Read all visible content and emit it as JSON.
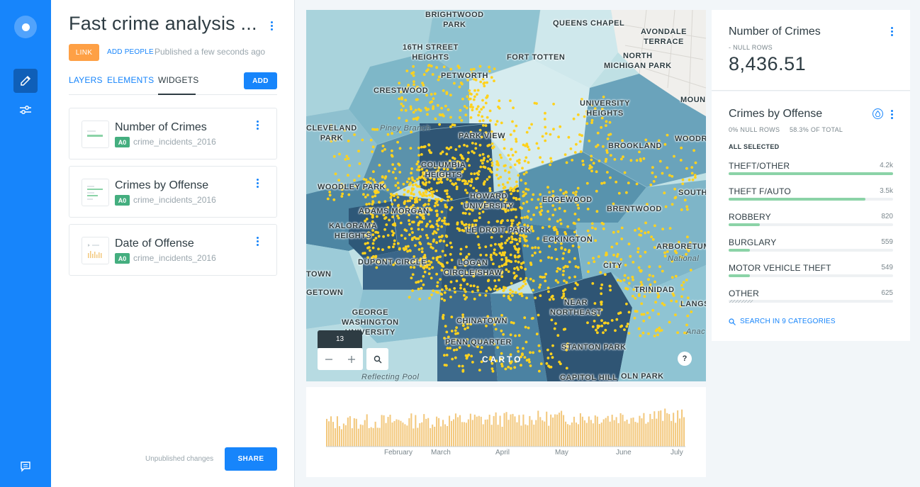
{
  "sidebar": {
    "nav": [
      "edit-map",
      "map-settings",
      "feedback"
    ]
  },
  "editor": {
    "title": "Fast crime analysis ...",
    "link_label": "LINK",
    "add_people_label": "ADD PEOPLE",
    "published_text": "Published a few seconds ago",
    "tabs": [
      {
        "label": "LAYERS"
      },
      {
        "label": "ELEMENTS"
      },
      {
        "label": "WIDGETS"
      }
    ],
    "active_tab": "WIDGETS",
    "add_label": "ADD",
    "widgets": [
      {
        "name": "Number of Crimes",
        "badge": "A0",
        "dataset": "crime_incidents_2016"
      },
      {
        "name": "Crimes by Offense",
        "badge": "A0",
        "dataset": "crime_incidents_2016"
      },
      {
        "name": "Date of Offense",
        "badge": "A0",
        "dataset": "crime_incidents_2016"
      }
    ],
    "unpublished_text": "Unpublished changes",
    "share_label": "SHARE"
  },
  "map": {
    "labels": [
      "BRIGHTWOOD\nPARK",
      "QUEENS CHAPEL",
      "AVONDALE\nTERRACE",
      "16TH STREET\nHEIGHTS",
      "FORT TOTTEN",
      "NORTH\nMICHIGAN PARK",
      "PETWORTH",
      "CRESTWOOD",
      "UNIVERSITY\nHEIGHTS",
      "MOUN",
      "CLEVELAND\nPARK",
      "Piney Branch",
      "PARK VIEW",
      "BROOKLAND",
      "WOODR",
      "COLUMBIA\nHEIGHTS",
      "WOODLEY PARK",
      "HOWARD\nUNIVERSITY",
      "EDGEWOOD",
      "BRENTWOOD",
      "SOUTH",
      "ADAMS MORGAN",
      "KALORAMA\nHEIGHTS",
      "LE DROIT PARK",
      "ECKINGTON",
      "ARBORETUM",
      "DUPONT CIRCLE",
      "LOGAN\nCIRCLE/SHAW",
      "CITY",
      "National",
      "TOWN",
      "TRINIDAD",
      "GETOWN",
      "NEAR\nNORTHEAST",
      "LANGSTON",
      "GEORGE\nWASHINGTON\nUNIVERSITY",
      "CHINATOWN",
      "Anac",
      "PENN QUARTER",
      "STANTON PARK",
      "Reflecting Pool",
      "CAPITOL HILL",
      "OLN PARK"
    ],
    "zoom_level": "13",
    "attribution": "CARTO",
    "help_label": "?"
  },
  "timeline": {
    "months": [
      "February",
      "March",
      "April",
      "May",
      "June",
      "July"
    ],
    "bar_color": "#f3c97f"
  },
  "widgets_panel": {
    "count_widget": {
      "title": "Number of Crimes",
      "null_rows": "- NULL ROWS",
      "value": "8,436.51"
    },
    "category_widget": {
      "title": "Crimes by Offense",
      "null_rows": "0% NULL ROWS",
      "of_total": "58.3% OF TOTAL",
      "all_selected": "ALL SELECTED",
      "categories": [
        {
          "name": "THEFT/OTHER",
          "value": "4.2k",
          "fraction": 1.0
        },
        {
          "name": "THEFT F/AUTO",
          "value": "3.5k",
          "fraction": 0.83
        },
        {
          "name": "ROBBERY",
          "value": "820",
          "fraction": 0.19
        },
        {
          "name": "BURGLARY",
          "value": "559",
          "fraction": 0.13
        },
        {
          "name": "MOTOR VEHICLE THEFT",
          "value": "549",
          "fraction": 0.13
        },
        {
          "name": "OTHER",
          "value": "625",
          "fraction": 0.15
        }
      ],
      "search_label": "SEARCH IN 9 CATEGORIES"
    }
  },
  "colors": {
    "accent": "#1785fb",
    "link_orange": "#fea045",
    "badge_green": "#44ae7f",
    "category_bar": "#8bd3a7",
    "points": "#ffd21e"
  }
}
